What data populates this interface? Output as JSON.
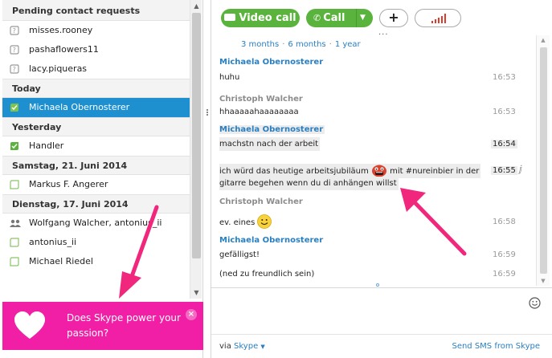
{
  "contacts": {
    "groups": [
      {
        "title": "Pending contact requests",
        "items": [
          {
            "name": "misses.rooney",
            "icon": "pending-contact-icon"
          },
          {
            "name": "pashaflowers11",
            "icon": "pending-contact-icon"
          },
          {
            "name": "lacy.piqueras",
            "icon": "pending-contact-icon"
          }
        ]
      },
      {
        "title": "Today",
        "items": [
          {
            "name": "Michaela Obernosterer",
            "icon": "online-status-icon",
            "selected": true
          }
        ]
      },
      {
        "title": "Yesterday",
        "items": [
          {
            "name": "Handler",
            "icon": "online-status-icon"
          }
        ]
      },
      {
        "title": "Samstag, 21. Juni 2014",
        "items": [
          {
            "name": "Markus F. Angerer",
            "icon": "offline-status-icon"
          }
        ]
      },
      {
        "title": "Dienstag, 17. Juni 2014",
        "items": [
          {
            "name": "Wolfgang Walcher, antonius_ii",
            "icon": "group-chat-icon"
          },
          {
            "name": "antonius_ii",
            "icon": "offline-status-icon"
          },
          {
            "name": "Michael Riedel",
            "icon": "offline-status-icon"
          }
        ]
      }
    ]
  },
  "promo": {
    "text": "Does Skype power your passion?",
    "close": "×"
  },
  "toolbar": {
    "video_call": "Video call",
    "call": "Call",
    "add": "+"
  },
  "history": {
    "links": [
      "3 months",
      "6 months",
      "1 year"
    ]
  },
  "messages": [
    {
      "sender": "Michaela Obernosterer",
      "sender_style": "blue",
      "text": "huhu",
      "time": "16:53"
    },
    {
      "sender": "Christoph Walcher",
      "sender_style": "grey",
      "text": "hhaaaaahaaaaaaaa",
      "time": "16:53"
    },
    {
      "sender": "Michaela Obernosterer",
      "sender_style": "blue",
      "text": "machstn nach der arbeit",
      "time": "16:54"
    },
    {
      "sender": "",
      "text_line1": "ich würd das heutige arbeitsjubiläum",
      "text_line1_after": "mit #nureinbier in der",
      "text_line2": "gitarre begehen wenn du di anhängen willst",
      "time": "16:55"
    },
    {
      "sender": "Christoph Walcher",
      "sender_style": "grey",
      "text": "ev. eines",
      "time": "16:58"
    },
    {
      "sender": "Michaela Obernosterer",
      "sender_style": "blue",
      "text": "gefälligst!",
      "time": "16:59"
    },
    {
      "sender": "",
      "text": "(ned zu freundlich sein)",
      "time": "16:59"
    }
  ],
  "input": {
    "placeholder": "",
    "value": ""
  },
  "footer": {
    "via_prefix": "via",
    "via_link": "Skype",
    "sms_link": "Send SMS from Skype"
  },
  "colors": {
    "accent_blue": "#2a7fc1",
    "selection": "#1e8fcf",
    "call_green": "#5ab33c",
    "promo_pink": "#f01fa6",
    "annotation_arrow": "#f0277d"
  }
}
